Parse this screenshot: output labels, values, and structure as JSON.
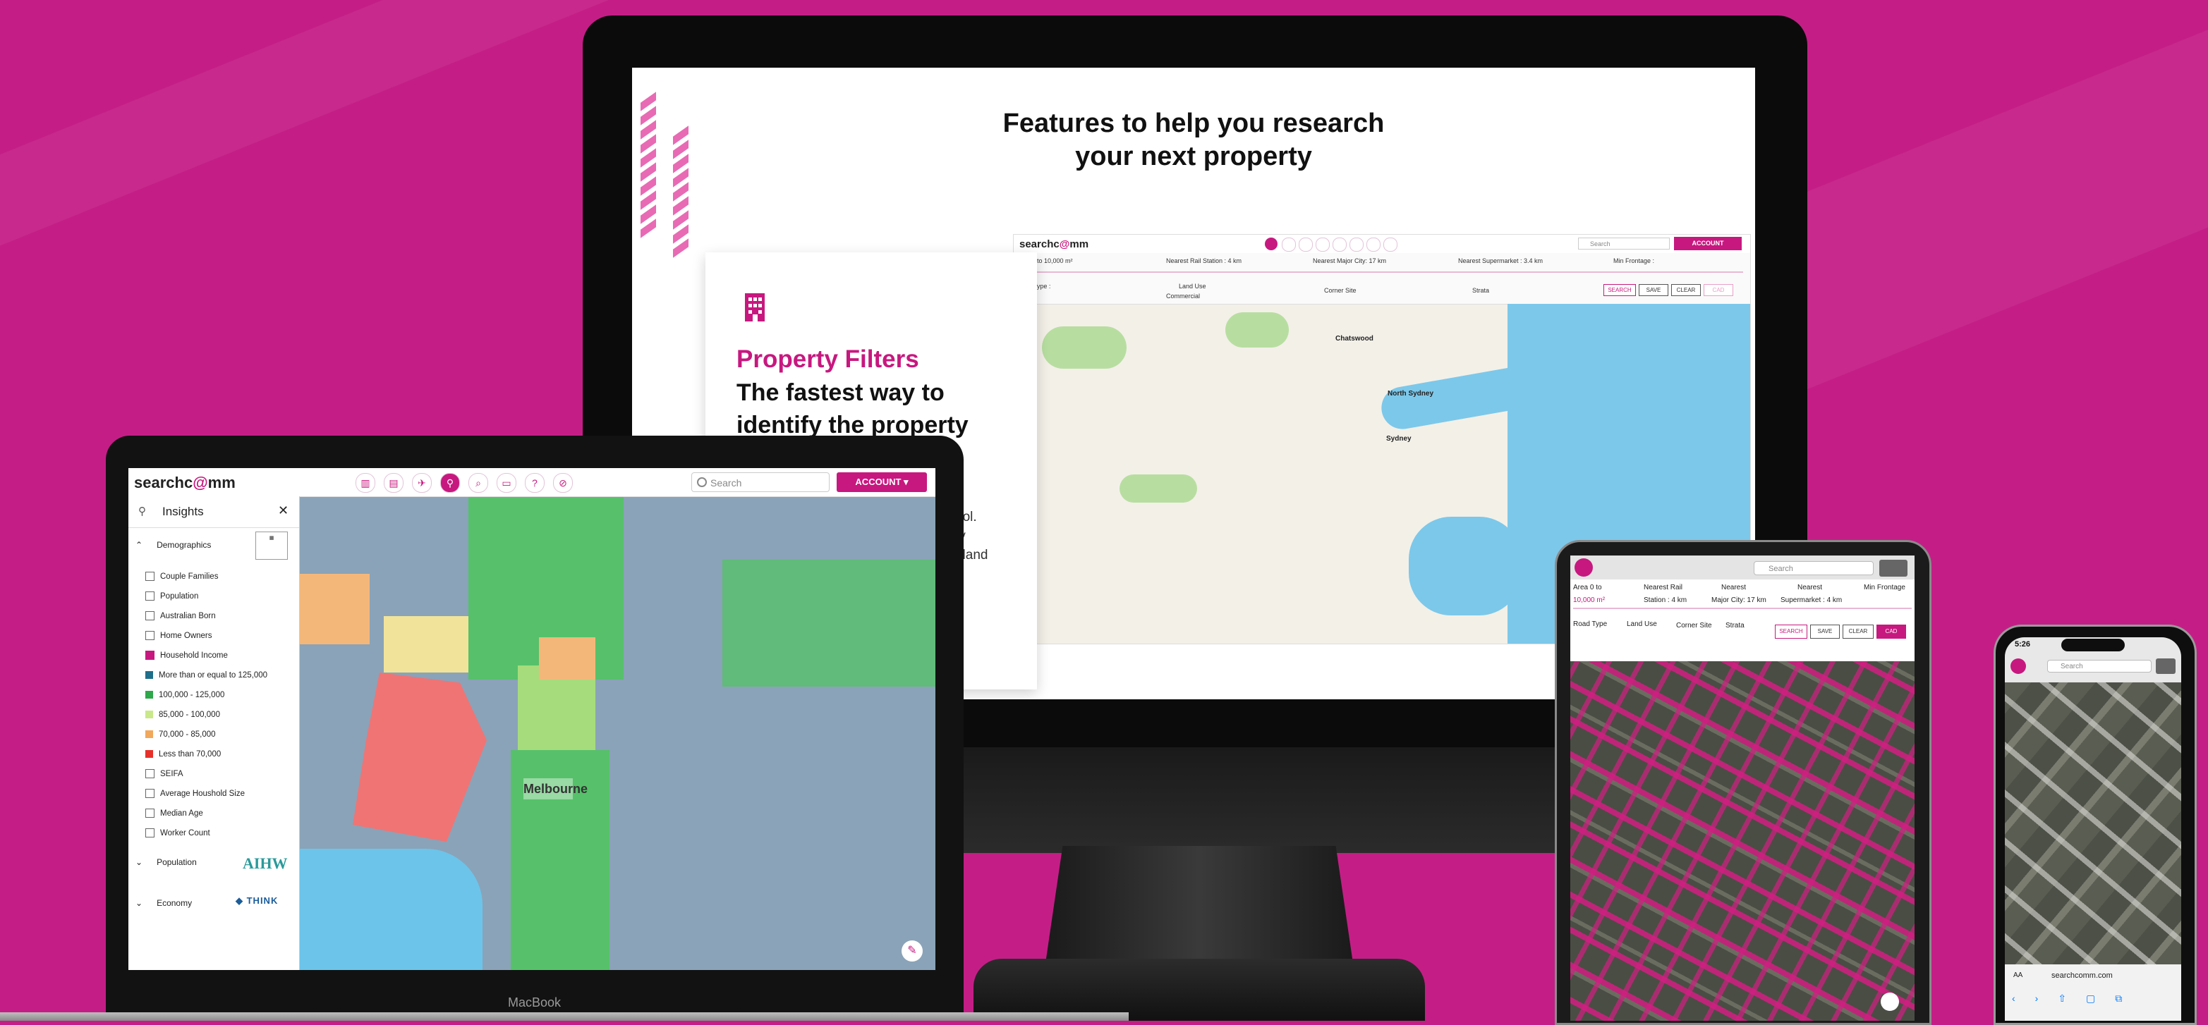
{
  "colors": {
    "background": "#c41e86",
    "brand": "#c7187f"
  },
  "monitor": {
    "headline_line1": "Features to help you research",
    "headline_line2": "your next property",
    "card": {
      "icon": "building-icon",
      "heading": "Property Filters",
      "title": "The fastest way to identify the property",
      "body_fragment_1": "ool.",
      "body_fragment_2": "ty",
      "body_fragment_3": ", land"
    },
    "map": {
      "logo_prefix": "searchc",
      "logo_accent": "@",
      "logo_suffix": "mm",
      "search_placeholder": "Search",
      "account_label": "ACCOUNT",
      "filters": {
        "area": "Area 0 to 10,000 m²",
        "nearest_rail": "Nearest Rail Station : 4 km",
        "nearest_major_city": "Nearest Major City: 17 km",
        "nearest_supermarket": "Nearest Supermarket : 3.4 km",
        "min_frontage": "Min Frontage :",
        "road_type": "Road Type :",
        "land_use": "Land Use",
        "land_use_value": "Commercial",
        "corner_site": "Corner Site",
        "strata": "Strata"
      },
      "buttons": {
        "search": "SEARCH",
        "save": "SAVE",
        "clear": "CLEAR",
        "cad": "CAD"
      },
      "places": [
        "Chatswood",
        "North Sydney",
        "Sydney"
      ]
    }
  },
  "laptop": {
    "brand_label": "MacBook",
    "logo_prefix": "searchc",
    "logo_accent": "@",
    "logo_suffix": "mm",
    "search_placeholder": "Search",
    "account_label": "ACCOUNT",
    "nav_icons": [
      "building-icon",
      "store-icon",
      "plane-icon",
      "insights-icon",
      "search-zoom-icon",
      "folder-icon",
      "help-icon",
      "layers-off-icon"
    ],
    "insights": {
      "title": "Insights",
      "section_demographics": "Demographics",
      "items": [
        {
          "label": "Couple Families",
          "checked": false
        },
        {
          "label": "Population",
          "checked": false
        },
        {
          "label": "Australian Born",
          "checked": false
        },
        {
          "label": "Home Owners",
          "checked": false
        },
        {
          "label": "Household Income",
          "checked": true
        }
      ],
      "legend": [
        {
          "label": "More than or equal to 125,000",
          "color": "#1f6f8b"
        },
        {
          "label": "100,000 - 125,000",
          "color": "#2ea84a"
        },
        {
          "label": "85,000 - 100,000",
          "color": "#c9e88a"
        },
        {
          "label": "70,000 - 85,000",
          "color": "#f2a85a"
        },
        {
          "label": "Less than 70,000",
          "color": "#e8302a"
        }
      ],
      "items_after": [
        "SEIFA",
        "Average Houshold Size",
        "Median Age",
        "Worker Count"
      ],
      "section_population": "Population",
      "section_economy": "Economy",
      "logo_aihw": "AIHW",
      "logo_think": "THINK"
    },
    "map_label": "Melbourne"
  },
  "tablet": {
    "search_placeholder": "Search",
    "filters": {
      "area": "Area 0 to",
      "nearest_rail": "Nearest Rail",
      "nearest_1": "Nearest",
      "nearest_2": "Nearest",
      "min_frontage": "Min Frontage",
      "area_value": "10,000 m²",
      "station": "Station : 4 km",
      "major_city": "Major City: 17 km",
      "supermarket": "Supermarket : 4 km",
      "road_type": "Road Type",
      "land_use": "Land Use",
      "corner_site": "Corner Site",
      "strata": "Strata"
    },
    "buttons": {
      "search": "SEARCH",
      "save": "SAVE",
      "clear": "CLEAR",
      "cad": "CAD"
    }
  },
  "phone": {
    "time": "5:26",
    "search_placeholder": "Search",
    "address_bar": "searchcomm.com",
    "aa_label": "AA"
  }
}
